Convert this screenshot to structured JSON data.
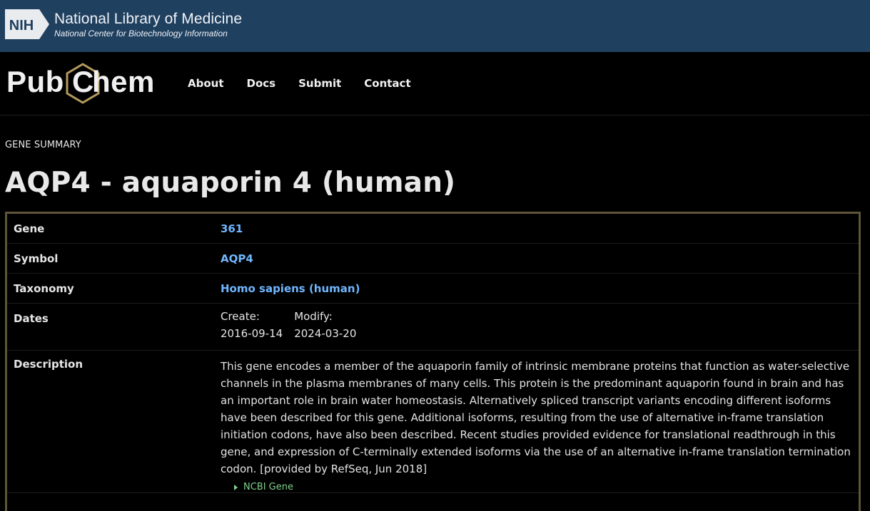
{
  "nih": {
    "logo_text": "NIH",
    "title": "National Library of Medicine",
    "subtitle": "National Center for Biotechnology Information"
  },
  "pubchem": {
    "logo_text_left": "Pub",
    "logo_text_mid": "C",
    "logo_text_right": "hem",
    "nav": [
      "About",
      "Docs",
      "Submit",
      "Contact"
    ]
  },
  "summary": {
    "label": "GENE SUMMARY",
    "title": "AQP4 - aquaporin 4 (human)"
  },
  "table": {
    "gene_label": "Gene",
    "gene_value": "361",
    "symbol_label": "Symbol",
    "symbol_value": "AQP4",
    "taxonomy_label": "Taxonomy",
    "taxonomy_value": "Homo sapiens (human)",
    "dates_label": "Dates",
    "create_label": "Create:",
    "create_value": "2016-09-14",
    "modify_label": "Modify:",
    "modify_value": "2024-03-20",
    "description_label": "Description",
    "description_text": "This gene encodes a member of the aquaporin family of intrinsic membrane proteins that function as water-selective channels in the plasma membranes of many cells. This protein is the predominant aquaporin found in brain and has an important role in brain water homeostasis. Alternatively spliced transcript variants encoding different isoforms have been described for this gene. Additional isoforms, resulting from the use of alternative in-frame translation initiation codons, have also been described. Recent studies provided evidence for translational readthrough in this gene, and expression of C-terminally extended isoforms via the use of an alternative in-frame translation termination codon. [provided by RefSeq, Jun 2018]",
    "ncbi_gene_label": "NCBI Gene"
  },
  "colors": {
    "nih_banner": "#20405f",
    "link": "#6fb6ff",
    "table_border": "#5e5437",
    "ncbi_toggle": "#7ed38b"
  }
}
